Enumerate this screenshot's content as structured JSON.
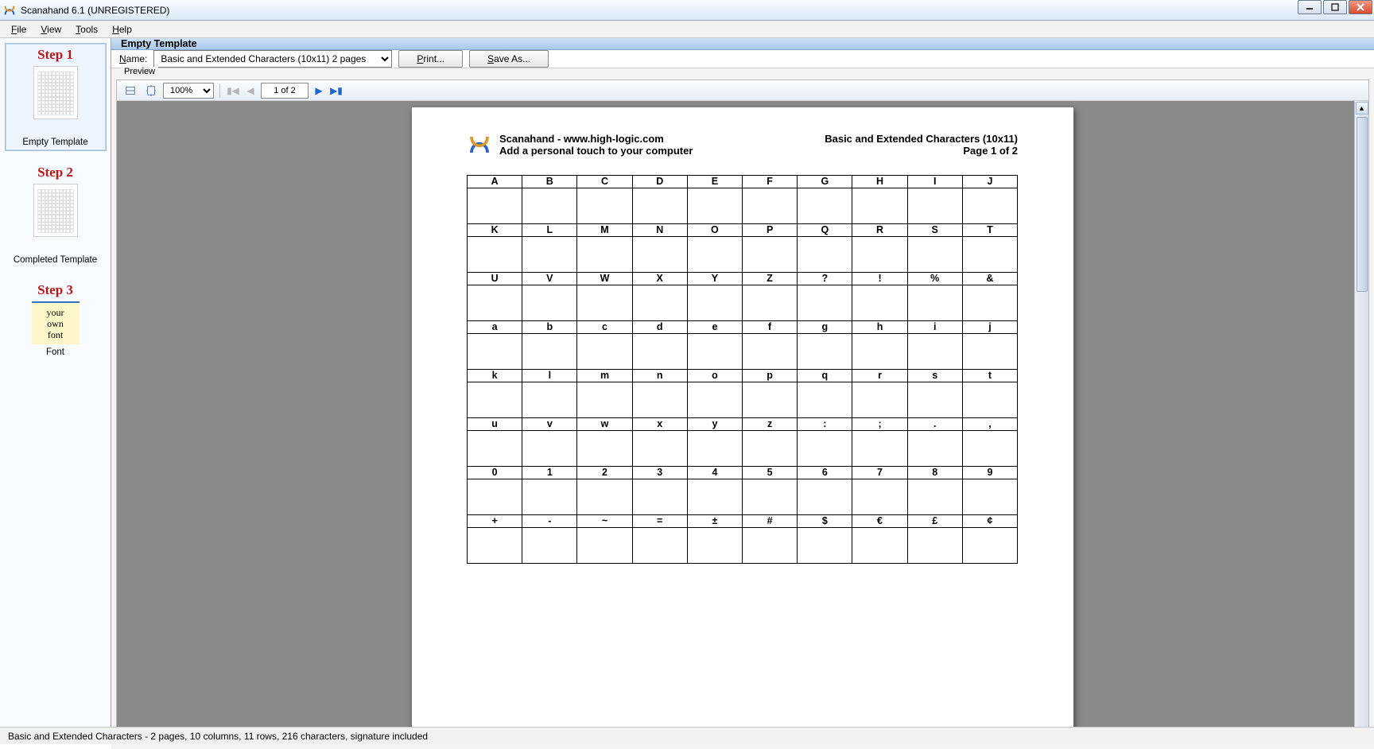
{
  "window": {
    "title": "Scanahand 6.1 (UNREGISTERED)"
  },
  "menu": {
    "file": "File",
    "view": "View",
    "tools": "Tools",
    "help": "Help"
  },
  "sidebar": {
    "step1": {
      "label": "Step 1",
      "caption": "Empty Template"
    },
    "step2": {
      "label": "Step 2",
      "caption": "Completed Template"
    },
    "step3": {
      "label": "Step 3",
      "thumb_l1": "your",
      "thumb_l2": "own",
      "thumb_l3": "font",
      "caption": "Font"
    }
  },
  "panel": {
    "heading": "Empty Template",
    "name_label": "Name:",
    "name_value": "Basic and Extended Characters (10x11) 2 pages",
    "print_btn": "Print...",
    "saveas_btn": "Save As...",
    "preview_label": "Preview"
  },
  "preview_toolbar": {
    "zoom": "100%",
    "page_text": "1 of 2"
  },
  "page": {
    "brand_line1": "Scanahand - www.high-logic.com",
    "brand_line2": "Add a personal touch to your computer",
    "right_line1": "Basic and Extended Characters (10x11)",
    "right_line2": "Page 1 of 2",
    "rows": [
      [
        "A",
        "B",
        "C",
        "D",
        "E",
        "F",
        "G",
        "H",
        "I",
        "J"
      ],
      [
        "K",
        "L",
        "M",
        "N",
        "O",
        "P",
        "Q",
        "R",
        "S",
        "T"
      ],
      [
        "U",
        "V",
        "W",
        "X",
        "Y",
        "Z",
        "?",
        "!",
        "%",
        "&"
      ],
      [
        "a",
        "b",
        "c",
        "d",
        "e",
        "f",
        "g",
        "h",
        "i",
        "j"
      ],
      [
        "k",
        "l",
        "m",
        "n",
        "o",
        "p",
        "q",
        "r",
        "s",
        "t"
      ],
      [
        "u",
        "v",
        "w",
        "x",
        "y",
        "z",
        ":",
        ";",
        ".",
        ","
      ],
      [
        "0",
        "1",
        "2",
        "3",
        "4",
        "5",
        "6",
        "7",
        "8",
        "9"
      ],
      [
        "+",
        "-",
        "~",
        "=",
        "±",
        "#",
        "$",
        "€",
        "£",
        "¢"
      ]
    ]
  },
  "statusbar": {
    "text": "Basic and Extended Characters - 2 pages, 10 columns, 11 rows, 216 characters, signature included"
  }
}
